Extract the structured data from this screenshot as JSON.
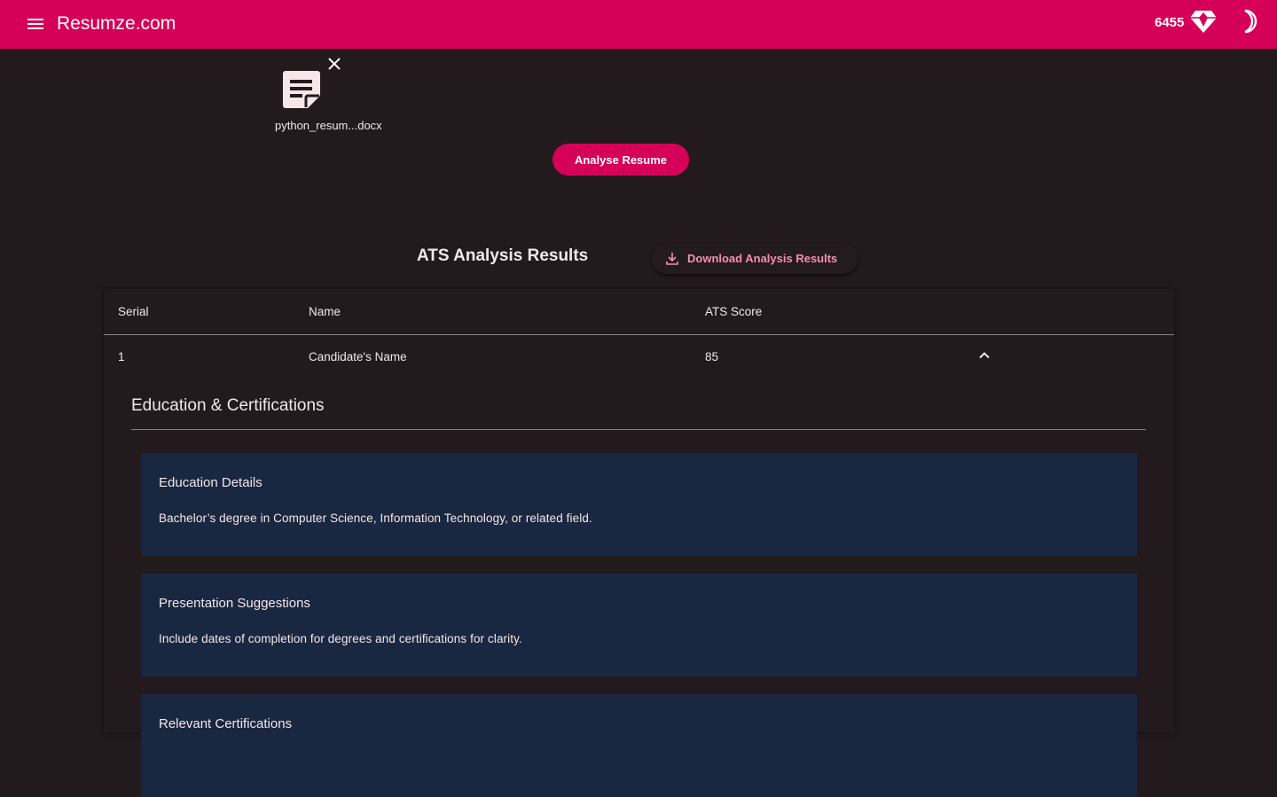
{
  "appbar": {
    "title": "Resumze.com",
    "credits": "6455",
    "menu_icon": "menu-icon",
    "gem_icon": "gem-icon",
    "theme_icon": "dark-mode-icon",
    "color": "#d50057"
  },
  "upload": {
    "file_name": "python_resum...docx",
    "file_icon": "document-icon",
    "remove_icon": "close-icon"
  },
  "actions": {
    "analyse_label": "Analyse Resume"
  },
  "results": {
    "title": "ATS Analysis Results",
    "download_label": "Download Analysis Results",
    "download_icon": "download-icon",
    "table": {
      "columns": [
        "Serial",
        "Name",
        "ATS Score"
      ],
      "rows": [
        {
          "serial": "1",
          "name": "Candidate's Name",
          "score": "85",
          "expand_icon": "chevron-up-icon"
        }
      ]
    },
    "section": {
      "title": "Education & Certifications",
      "cards": [
        {
          "title": "Education Details",
          "body": "Bachelor’s degree in Computer Science, Information Technology, or related field."
        },
        {
          "title": "Presentation Suggestions",
          "body": "Include dates of completion for degrees and certifications for clarity."
        },
        {
          "title": "Relevant Certifications",
          "body": ""
        }
      ]
    }
  },
  "colors": {
    "accent": "#d50057",
    "background": "#231a1e",
    "card": "#1a2740",
    "link": "#f48fb1"
  }
}
